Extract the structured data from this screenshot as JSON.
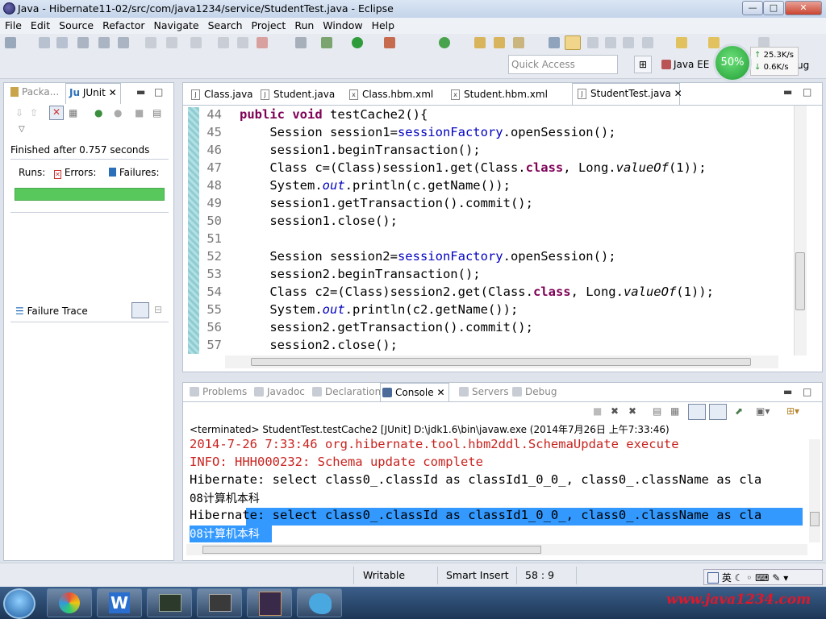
{
  "window": {
    "title": "Java - Hibernate11-02/src/com/java1234/service/StudentTest.java - Eclipse",
    "minimize": "—",
    "maximize": "□",
    "close": "✕"
  },
  "menu": [
    "File",
    "Edit",
    "Source",
    "Refactor",
    "Navigate",
    "Search",
    "Project",
    "Run",
    "Window",
    "Help"
  ],
  "toolbar": {
    "quick_access_placeholder": "Quick Access",
    "perspective_java_ee": "Java EE",
    "perspective_debug": "ug",
    "net_percent": "50%",
    "net_up": "25.3K/s",
    "net_down": "0.6K/s"
  },
  "left_panel": {
    "tabs": [
      "Packa...",
      "JUnit"
    ],
    "finished": "Finished after 0.757 seconds",
    "runs_label": "Runs:",
    "errors_label": "Errors:",
    "failures_label": "Failures:",
    "failure_trace": "Failure Trace",
    "status_color": "#58c85c"
  },
  "editor": {
    "tabs": [
      "Class.java",
      "Student.java",
      "Class.hbm.xml",
      "Student.hbm.xml",
      "StudentTest.java"
    ],
    "active_tab": "StudentTest.java",
    "line_numbers": [
      "44",
      "45",
      "46",
      "47",
      "48",
      "49",
      "50",
      "51",
      "52",
      "53",
      "54",
      "55",
      "56",
      "57"
    ]
  },
  "console": {
    "tabs": [
      "Problems",
      "Javadoc",
      "Declaration",
      "Console",
      "Servers",
      "Debug"
    ],
    "active_tab": "Console",
    "header": "<terminated> StudentTest.testCache2 [JUnit] D:\\jdk1.6\\bin\\javaw.exe (2014年7月26日 上午7:33:46)",
    "lines": [
      "2014-7-26 7:33:46 org.hibernate.tool.hbm2ddl.SchemaUpdate execute",
      "INFO: HHH000232: Schema update complete",
      "Hibernate: select class0_.classId as classId1_0_0_, class0_.className as cla",
      "08计算机本科",
      "Hibernate: select class0_.classId as classId1_0_0_, class0_.className as cla",
      "08计算机本科"
    ]
  },
  "status": {
    "writable": "Writable",
    "insert_mode": "Smart Insert",
    "position": "58 : 9",
    "ime": "英"
  },
  "taskbar": {
    "watermark": "www.java1234.com"
  }
}
